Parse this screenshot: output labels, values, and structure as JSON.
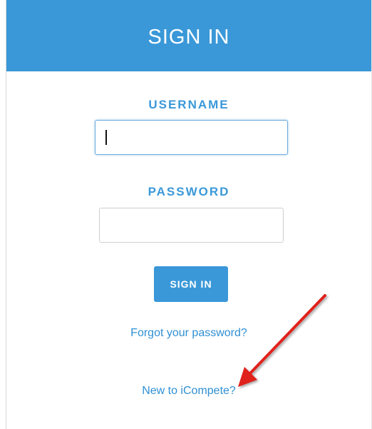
{
  "header": {
    "title": "SIGN IN"
  },
  "form": {
    "username_label": "USERNAME",
    "username_value": "",
    "password_label": "PASSWORD",
    "password_value": "",
    "submit_label": "SIGN IN"
  },
  "links": {
    "forgot_password": "Forgot your password?",
    "new_user": "New to iCompete?"
  },
  "annotation": {
    "arrow_color": "#e0201b"
  },
  "colors": {
    "accent": "#3a98d8",
    "link": "#2f8fd3"
  }
}
